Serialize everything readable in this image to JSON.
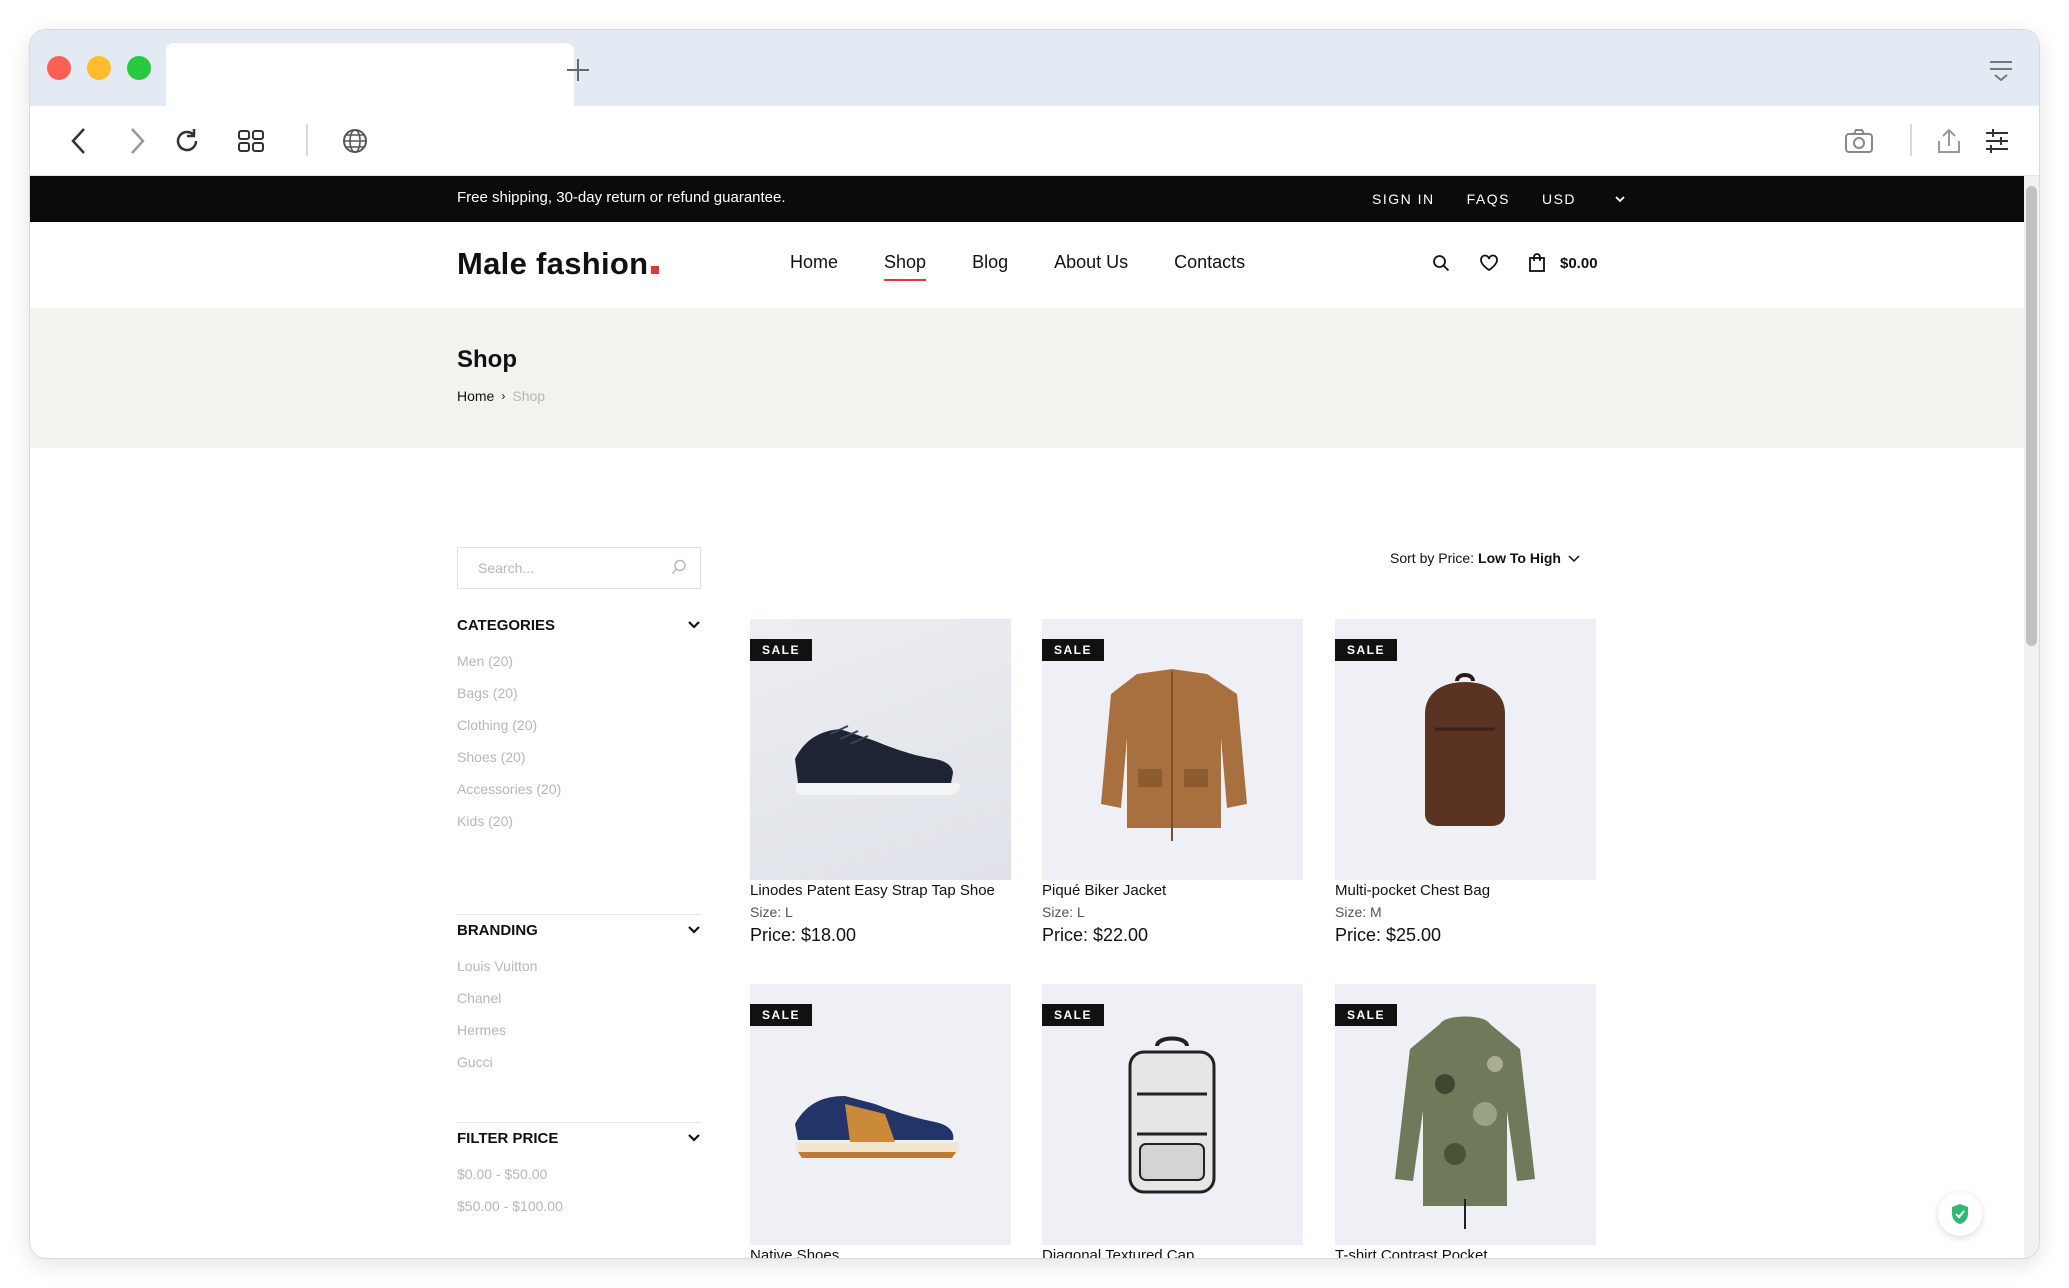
{
  "browser": {
    "tab_title": "",
    "icons": [
      "chevron-left-icon",
      "chevron-right-icon",
      "reload-icon",
      "grid-icon",
      "globe-icon",
      "camera-icon",
      "share-icon",
      "sliders-icon"
    ]
  },
  "topbar": {
    "message": "Free shipping, 30-day return or refund guarantee.",
    "sign_in": "SIGN IN",
    "faqs": "FAQS",
    "currency": "USD"
  },
  "header": {
    "logo": "Male fashion",
    "nav": [
      "Home",
      "Shop",
      "Blog",
      "About Us",
      "Contacts"
    ],
    "active_nav": "Shop",
    "cart_total": "$0.00"
  },
  "breadcrumb": {
    "title": "Shop",
    "home": "Home",
    "current": "Shop"
  },
  "sidebar": {
    "search_placeholder": "Search...",
    "categories": {
      "title": "CATEGORIES",
      "items": [
        "Men (20)",
        "Bags (20)",
        "Clothing (20)",
        "Shoes (20)",
        "Accessories (20)",
        "Kids (20)"
      ]
    },
    "branding": {
      "title": "BRANDING",
      "items": [
        "Louis Vuitton",
        "Chanel",
        "Hermes",
        "Gucci"
      ]
    },
    "filter_price": {
      "title": "FILTER PRICE",
      "items": [
        "$0.00 - $50.00",
        "$50.00 - $100.00"
      ]
    }
  },
  "sort": {
    "label": "Sort by Price:",
    "value": "Low To High"
  },
  "products": [
    {
      "badge": "SALE",
      "name": "Linodes Patent Easy Strap Tap Shoe",
      "size": "Size: L",
      "price": "Price: $18.00"
    },
    {
      "badge": "SALE",
      "name": "Piqué Biker Jacket",
      "size": "Size: L",
      "price": "Price: $22.00"
    },
    {
      "badge": "SALE",
      "name": "Multi-pocket Chest Bag",
      "size": "Size: M",
      "price": "Price: $25.00"
    },
    {
      "badge": "SALE",
      "name": "Native Shoes",
      "size": "",
      "price": ""
    },
    {
      "badge": "SALE",
      "name": "Diagonal Textured Cap",
      "size": "",
      "price": ""
    },
    {
      "badge": "SALE",
      "name": "T-shirt Contrast Pocket",
      "size": "",
      "price": ""
    }
  ],
  "colors": {
    "accent": "#e53637",
    "topbar_bg": "#0b0b0b",
    "breadcrumb_bg": "#f3f2ee"
  }
}
